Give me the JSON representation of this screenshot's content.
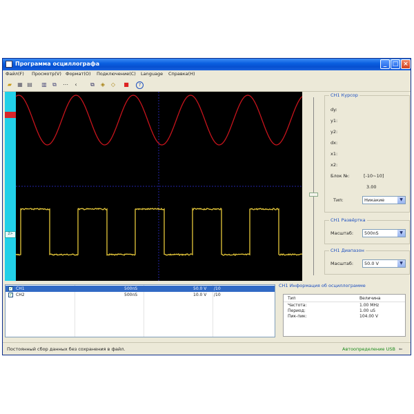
{
  "window": {
    "title": "Программа осциллографа"
  },
  "menu": [
    "Файл(F)",
    "Просмотр(V)",
    "Формат(O)",
    "Подключение(C)",
    "Language",
    "Справка(H)"
  ],
  "cursor_panel": {
    "title": "CH1 Курсор",
    "fields": [
      "dy:",
      "y1:",
      "y2:",
      "dx:",
      "x1:",
      "x2:"
    ],
    "block_label": "Блок №:",
    "block_value": "[-10~10]",
    "block_number": "3.00",
    "type_label": "Тип:",
    "type_value": "Никакие"
  },
  "sweep_panel": {
    "title": "CH1 Развёртка",
    "scale_label": "Масштаб:",
    "scale_value": "500nS"
  },
  "range_panel": {
    "title": "CH1 Диапазон",
    "scale_label": "Масштаб:",
    "scale_value": "50.0 V"
  },
  "channels": [
    {
      "name": "CH1",
      "timebase": "500nS",
      "volts": "50.0 V",
      "probe": "/10",
      "checked": true,
      "selected": true
    },
    {
      "name": "CH2",
      "timebase": "500nS",
      "volts": "10.0 V",
      "probe": "/10",
      "checked": true,
      "selected": false
    }
  ],
  "info": {
    "title": "CH1 Информация об осциллограмме",
    "headers": [
      "Тип",
      "Величина"
    ],
    "rows": [
      {
        "type": "Частота:",
        "value": "1.00 MHz"
      },
      {
        "type": "Период:",
        "value": "1.00 uS"
      },
      {
        "type": "Пик-пик:",
        "value": "104.00 V"
      }
    ]
  },
  "status": {
    "left": "Постоянный сбор данных без сохранения в файл.",
    "right": "Автоопределение USB"
  },
  "colors": {
    "sine": "#c8141c",
    "square": "#e6c83a",
    "grid": "#1d1d8a",
    "titlebar": "#0a5fe0"
  },
  "scope": {
    "waveforms": [
      "sine",
      "square"
    ],
    "cycles": 5
  }
}
